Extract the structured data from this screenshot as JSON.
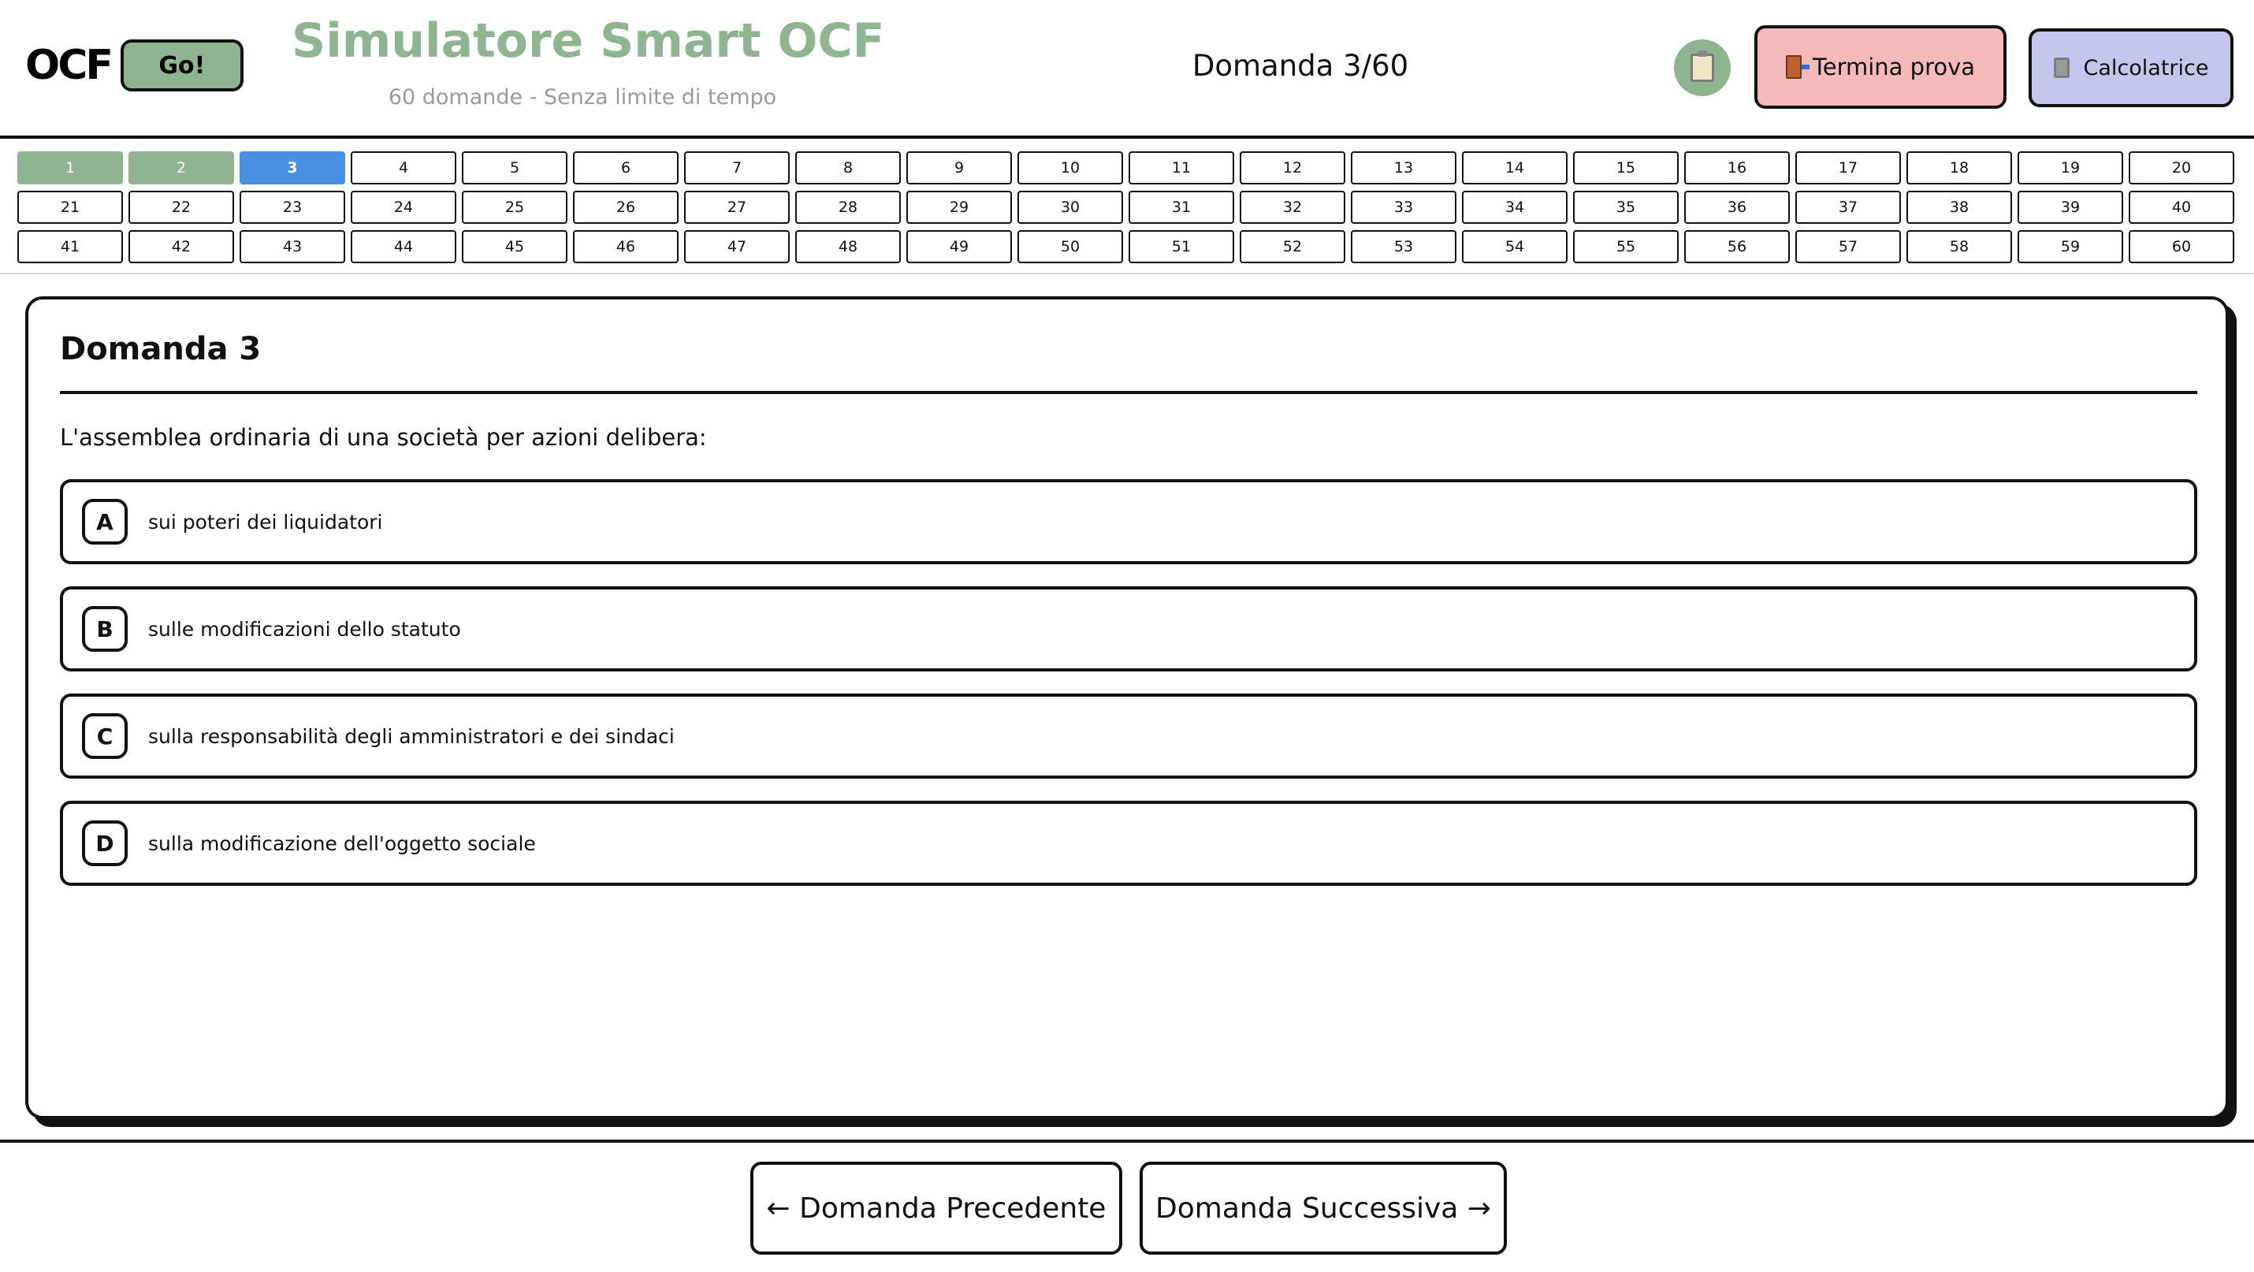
{
  "header": {
    "logo_text": "OCF",
    "logo_badge": "Go!",
    "title": "Simulatore Smart OCF",
    "subtitle": "60 domande - Senza limite di tempo",
    "counter": "Domanda 3/60",
    "end_label": "Termina prova",
    "calc_label": "Calcolatrice",
    "icons": {
      "notes": "clipboard-icon",
      "end": "door-exit-icon",
      "calc": "calculator-icon"
    },
    "colors": {
      "brand": "#8fb490",
      "end_bg": "#f4b9b9",
      "calc_bg": "#c5c6ec"
    }
  },
  "grid": {
    "total": 60,
    "current": 3,
    "answered": [
      1,
      2
    ],
    "labels": [
      "1",
      "2",
      "3",
      "4",
      "5",
      "6",
      "7",
      "8",
      "9",
      "10",
      "11",
      "12",
      "13",
      "14",
      "15",
      "16",
      "17",
      "18",
      "19",
      "20",
      "21",
      "22",
      "23",
      "24",
      "25",
      "26",
      "27",
      "28",
      "29",
      "30",
      "31",
      "32",
      "33",
      "34",
      "35",
      "36",
      "37",
      "38",
      "39",
      "40",
      "41",
      "42",
      "43",
      "44",
      "45",
      "46",
      "47",
      "48",
      "49",
      "50",
      "51",
      "52",
      "53",
      "54",
      "55",
      "56",
      "57",
      "58",
      "59",
      "60"
    ],
    "colors": {
      "answered": "#8fb490",
      "current": "#4a90e2"
    }
  },
  "question": {
    "title": "Domanda 3",
    "text": "L'assemblea ordinaria di una società per azioni delibera:",
    "options": [
      {
        "letter": "A",
        "text": "sui poteri dei liquidatori"
      },
      {
        "letter": "B",
        "text": "sulle modificazioni dello statuto"
      },
      {
        "letter": "C",
        "text": "sulla responsabilità degli amministratori e dei sindaci"
      },
      {
        "letter": "D",
        "text": "sulla modificazione dell'oggetto sociale"
      }
    ]
  },
  "footer": {
    "prev_arrow": "←",
    "prev_label": "Domanda Precedente",
    "next_label": "Domanda Successiva",
    "next_arrow": "→"
  }
}
